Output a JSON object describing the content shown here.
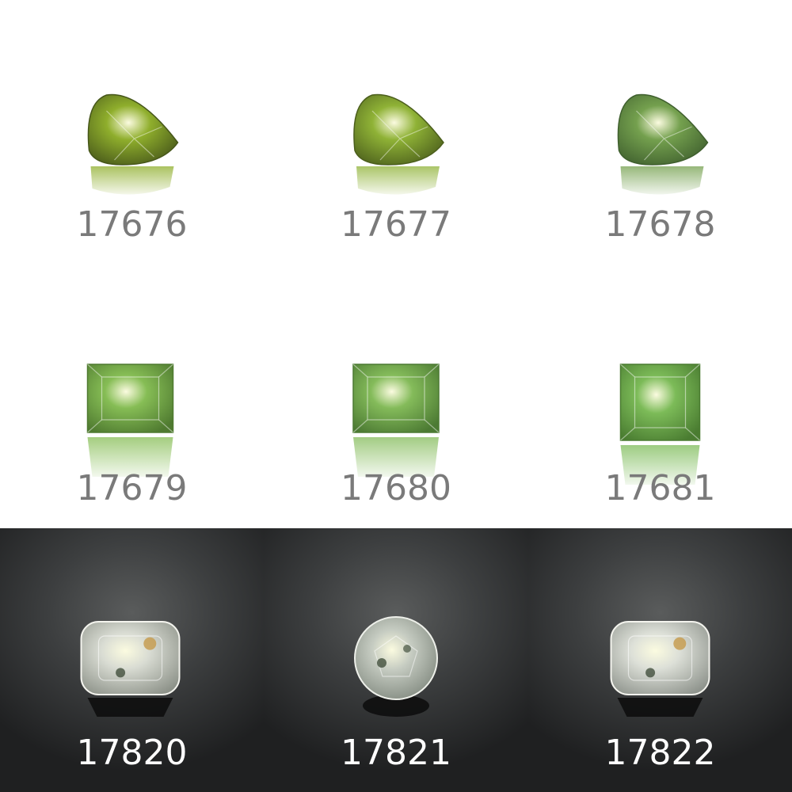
{
  "gems": [
    {
      "id": "17676",
      "shape": "pear",
      "tone": "light",
      "color": "#8fae2c",
      "dark": "#46561a"
    },
    {
      "id": "17677",
      "shape": "pear",
      "tone": "light",
      "color": "#8fb236",
      "dark": "#4b5e1c"
    },
    {
      "id": "17678",
      "shape": "pear",
      "tone": "light",
      "color": "#74a04e",
      "dark": "#3f5f2e"
    },
    {
      "id": "17679",
      "shape": "square",
      "tone": "light",
      "color": "#86bd55",
      "dark": "#4f7a30"
    },
    {
      "id": "17680",
      "shape": "square",
      "tone": "light",
      "color": "#84bb5a",
      "dark": "#4c7a33"
    },
    {
      "id": "17681",
      "shape": "square",
      "tone": "light",
      "color": "#7cbb58",
      "dark": "#4a7c31"
    },
    {
      "id": "17820",
      "shape": "cushion",
      "tone": "dark",
      "color": "#d9dcd3",
      "dark": "#8d9289"
    },
    {
      "id": "17821",
      "shape": "round",
      "tone": "dark",
      "color": "#c5cbc1",
      "dark": "#7c847a"
    },
    {
      "id": "17822",
      "shape": "cushion",
      "tone": "dark",
      "color": "#dde0d8",
      "dark": "#8f948d"
    }
  ]
}
